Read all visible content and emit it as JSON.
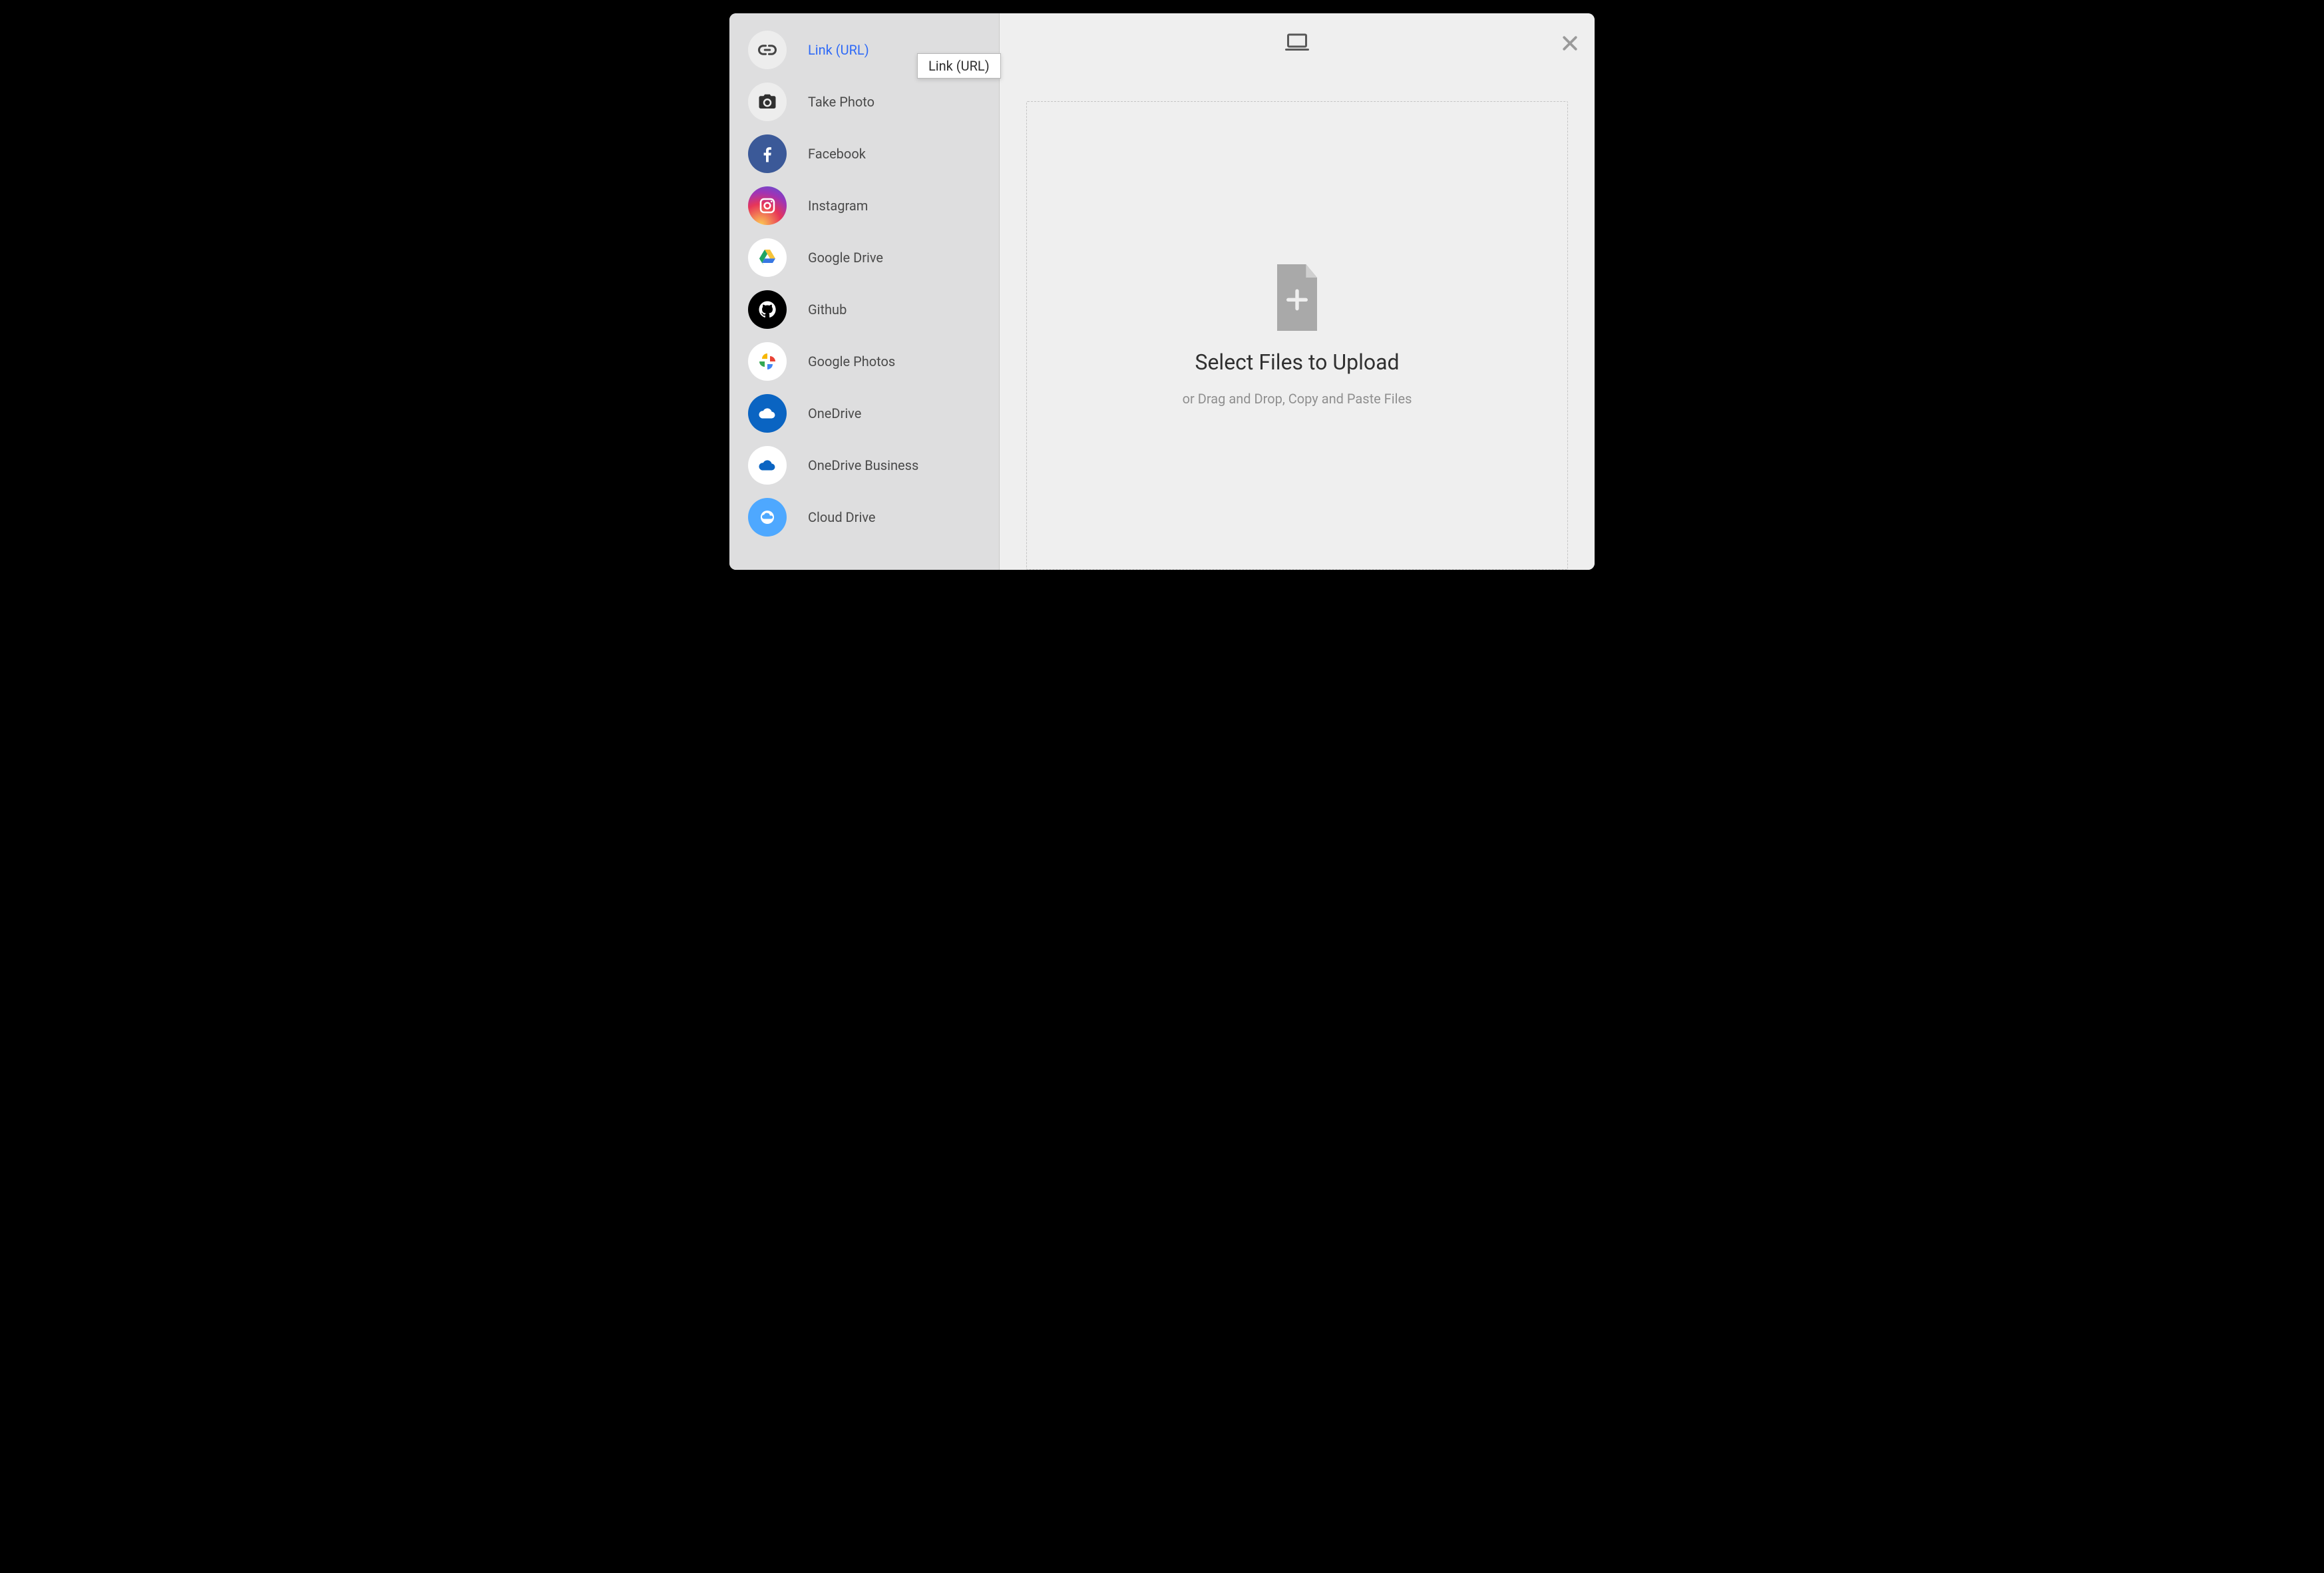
{
  "sidebar": {
    "items": [
      {
        "label": "Link (URL)",
        "icon": "link-icon",
        "active": true
      },
      {
        "label": "Take Photo",
        "icon": "camera-icon",
        "active": false
      },
      {
        "label": "Facebook",
        "icon": "facebook-icon",
        "active": false
      },
      {
        "label": "Instagram",
        "icon": "instagram-icon",
        "active": false
      },
      {
        "label": "Google Drive",
        "icon": "google-drive-icon",
        "active": false
      },
      {
        "label": "Github",
        "icon": "github-icon",
        "active": false
      },
      {
        "label": "Google Photos",
        "icon": "google-photos-icon",
        "active": false
      },
      {
        "label": "OneDrive",
        "icon": "onedrive-icon",
        "active": false
      },
      {
        "label": "OneDrive Business",
        "icon": "onedrive-business-icon",
        "active": false
      },
      {
        "label": "Cloud Drive",
        "icon": "cloud-drive-icon",
        "active": false
      }
    ]
  },
  "tooltip": {
    "text": "Link (URL)"
  },
  "header": {
    "device_icon": "laptop-icon"
  },
  "main": {
    "title": "Select Files to Upload",
    "subtitle": "or Drag and Drop, Copy and Paste Files"
  }
}
